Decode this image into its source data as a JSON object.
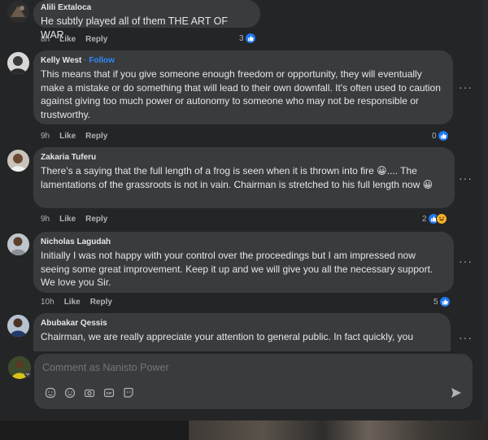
{
  "comments": [
    {
      "author": "Alili Extaloca",
      "text": "He subtly played all of them THE ART OF WAR",
      "time": "8h",
      "like_label": "Like",
      "reply_label": "Reply",
      "reaction_count": "3",
      "reactions": [
        "like-icon"
      ]
    },
    {
      "author": "Kelly West",
      "follow_label": "· Follow",
      "text": "This means that if you give someone enough freedom or opportunity, they will eventually make a mistake or do something that will lead to their own downfall. It's often used to caution against giving too much power or autonomy to someone who may not be responsible or trustworthy.",
      "time": "9h",
      "like_label": "Like",
      "reply_label": "Reply",
      "reaction_count": "0",
      "reactions": [
        "like-icon"
      ]
    },
    {
      "author": "Zakaria Tuferu",
      "text": "There's a saying that the full length of a frog is seen when it is thrown into fire 😀.... The lamentations of the grassroots is not in vain. Chairman is stretched to his full length now 😀",
      "time": "9h",
      "like_label": "Like",
      "reply_label": "Reply",
      "reaction_count": "2",
      "reactions": [
        "like-icon",
        "haha-icon"
      ]
    },
    {
      "author": "Nicholas Lagudah",
      "text": "Initially I was not happy with your control over the proceedings but I am impressed now seeing some great improvement. Keep it up and we will give you all the necessary support. We love you Sir.",
      "time": "10h",
      "like_label": "Like",
      "reply_label": "Reply",
      "reaction_count": "5",
      "reactions": [
        "like-icon"
      ]
    },
    {
      "author": "Abubakar Qessis",
      "text": "Chairman, we are really appreciate your attention to general public. In fact quickly, you",
      "more_label": "···"
    }
  ],
  "more_label": "···",
  "composer": {
    "placeholder": "Comment as Nanisto Power",
    "tools": [
      "sticker-icon",
      "emoji-icon",
      "camera-icon",
      "gif-icon",
      "avatar-sticker-icon"
    ],
    "send_icon": "send-icon"
  },
  "colors": {
    "panel": "#242526",
    "bubble": "#3a3b3c",
    "link": "#2d88ff",
    "like": "#2078f4",
    "secondary_text": "#b0b3b8"
  }
}
